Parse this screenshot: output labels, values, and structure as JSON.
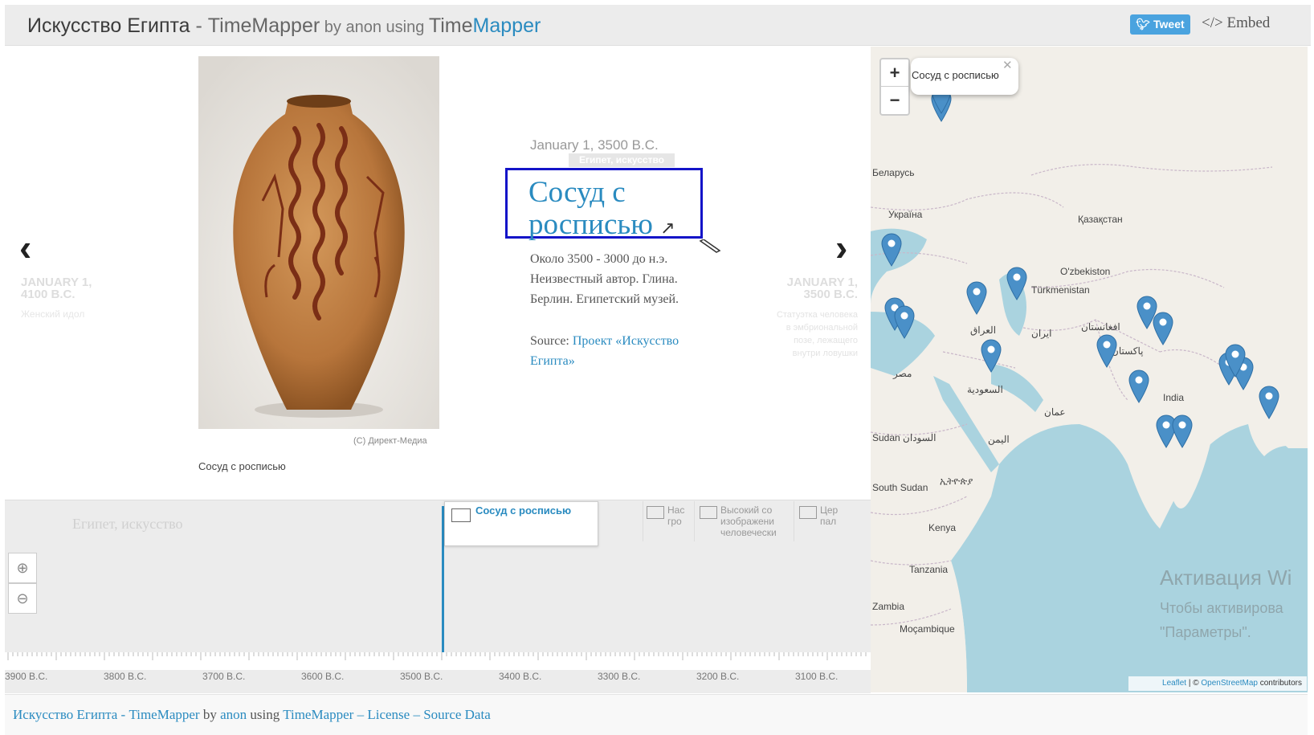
{
  "header": {
    "title": "Искусство Египта",
    "sep": " - ",
    "app": "TimeMapper",
    "by": " by ",
    "author": "anon",
    "using": " using ",
    "tool_a": "Time",
    "tool_b": "Mapper",
    "tweet_label": "Tweet",
    "embed_label": "</> Embed"
  },
  "slide": {
    "image_credit": "(C) Директ-Медиа",
    "image_caption": "Сосуд с росписью",
    "date": "January 1, 3500 B.C.",
    "tag": "Египет, искусство",
    "title": "Сосуд с росписью",
    "description": "Около 3500 - 3000 до н.э. Неизвестный автор. Глина. Берлин. Египетский музей.",
    "source_label": "Source: ",
    "source_link": "Проект «Искусство Египта»"
  },
  "nav": {
    "prev_date": "JANUARY 1, 4100 B.C.",
    "prev_title": "Женский идол",
    "next_date": "JANUARY 1, 3500 B.C.",
    "next_title": "Статуэтка человека в эмбриональной позе, лежащего внутри ловушки"
  },
  "map": {
    "popup_text": "Сосуд с росписью",
    "zoom_in": "+",
    "zoom_out": "−",
    "labels": [
      "Беларусь",
      "Україна",
      "Қазақстан",
      "O'zbekiston",
      "Türkmenistan",
      "ایران",
      "العراق",
      "افغانستان",
      "پاکستان",
      "India",
      "مصر",
      "السعودية",
      "عمان",
      "اليمن",
      "Sudan السودان",
      "South Sudan",
      "ኢትዮጵያ",
      "Kenya",
      "Tanzania",
      "Zambia",
      "Moçambique"
    ],
    "attribution_a": "Leaflet",
    "attribution_b": " | © ",
    "attribution_c": "OpenStreetMap",
    "attribution_d": " contributors"
  },
  "os_overlay": {
    "line1": "Активация Wi",
    "line2": "Чтобы активирова",
    "line3": "\"Параметры\"."
  },
  "timeline": {
    "group_label": "Египет, искусство",
    "active_card": "Сосуд с росписью",
    "other_cards": [
      "Нас гро",
      "Высокий со изображени человечески",
      "Цер пал"
    ],
    "axis_labels": [
      "3900 B.C.",
      "3800 B.C.",
      "3700 B.C.",
      "3600 B.C.",
      "3500 B.C.",
      "3400 B.C.",
      "3300 B.C.",
      "3200 B.C.",
      "3100 B.C."
    ]
  },
  "footer": {
    "title": "Искусство Египта",
    "sep": " - ",
    "app": "TimeMapper",
    "by": " by ",
    "author": "anon",
    "using": " using ",
    "tool": "TimeMapper",
    "dash1": " – ",
    "license": "License",
    "dash2": " – ",
    "source_data": "Source Data"
  },
  "colors": {
    "accent": "#2a8bc0",
    "header_bg": "#ececec",
    "tweet_bg": "#4aa3df",
    "highlight_box": "#1414c8",
    "map_water": "#aad3df",
    "map_land": "#f2efe9",
    "pin": "#4a90c8"
  },
  "icons": {
    "prev": "chevron-left-icon",
    "next": "chevron-right-icon",
    "external_link": "external-link-icon",
    "zoom_in": "zoom-in-icon",
    "zoom_out": "zoom-out-icon",
    "twitter": "twitter-bird-icon",
    "map_marker": "map-marker-icon",
    "image": "image-icon"
  }
}
